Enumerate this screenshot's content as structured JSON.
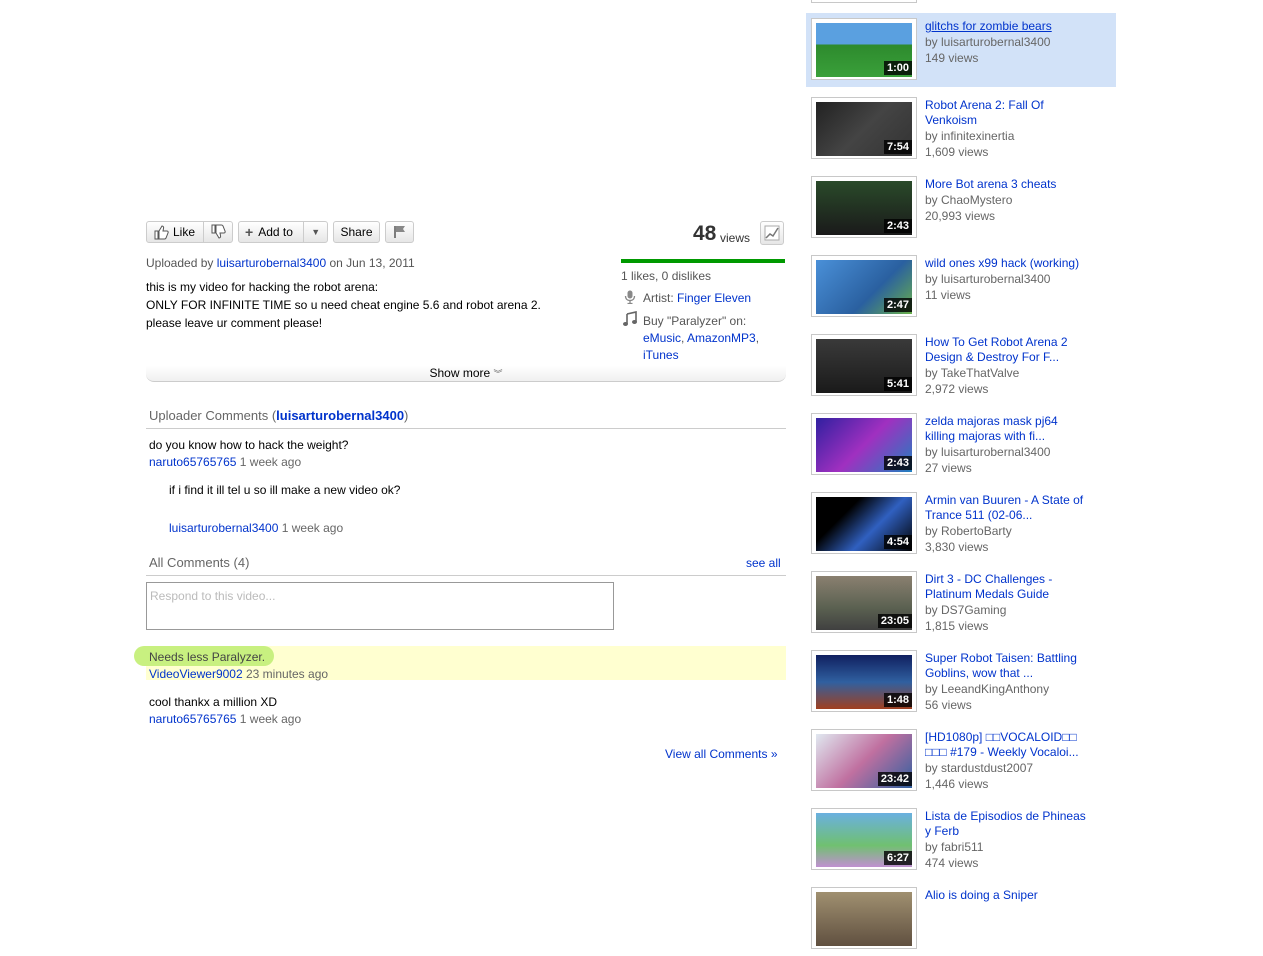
{
  "actions": {
    "like_label": "Like",
    "add_to_label": "Add to",
    "share_label": "Share"
  },
  "views": {
    "count": "48",
    "word": "views"
  },
  "ratings": {
    "text": "1 likes, 0 dislikes",
    "like_fraction": 1.0
  },
  "upload": {
    "prefix": "Uploaded by",
    "user": "luisarturobernal3400",
    "on": "on Jun 13, 2011"
  },
  "description": [
    "this is my video for hacking the robot arena:",
    "ONLY FOR INFINITE TIME so u need cheat engine 5.6 and robot arena 2.",
    "please leave ur comment please!"
  ],
  "music": {
    "artist_prefix": "Artist:",
    "artist": "Finger Eleven",
    "buy_prefix": "Buy \"Paralyzer\" on:",
    "stores": [
      "eMusic",
      "AmazonMP3",
      "iTunes"
    ]
  },
  "show_more": "Show more",
  "uploader_comments": {
    "title_prefix": "Uploader Comments (",
    "title_user": "luisarturobernal3400",
    "title_suffix": ")",
    "items": [
      {
        "text": "do you know how to hack the weight?",
        "user": "naruto65765765",
        "time": "1 week ago"
      },
      {
        "text": "if i find it ill tel u so ill make a new video ok?",
        "user": "luisarturobernal3400",
        "time": "1 week ago"
      }
    ]
  },
  "all_comments": {
    "title": "All Comments (4)",
    "see_all": "see all",
    "placeholder": "Respond to this video...",
    "items": [
      {
        "text": "Needs less Paralyzer.",
        "user": "VideoViewer9002",
        "time": "23 minutes ago"
      },
      {
        "text": "cool thankx a million XD",
        "user": "naruto65765765",
        "time": "1 week ago"
      }
    ],
    "view_all": "View all Comments »"
  },
  "sidebar": [
    {
      "title1": "glitchs for zombie bears",
      "title2": "",
      "by": "by luisarturobernal3400",
      "views": "149 views",
      "duration": "1:00",
      "active": true
    },
    {
      "title1": "Robot Arena 2: Fall Of",
      "title2": "Venkoism",
      "by": "by infinitexinertia",
      "views": "1,609 views",
      "duration": "7:54"
    },
    {
      "title1": "More Bot arena 3 cheats",
      "title2": "",
      "by": "by ChaoMystero",
      "views": "20,993 views",
      "duration": "2:43"
    },
    {
      "title1": "wild ones x99 hack (working)",
      "title2": "",
      "by": "by luisarturobernal3400",
      "views": "11 views",
      "duration": "2:47"
    },
    {
      "title1": "How To Get Robot Arena 2",
      "title2": "Design & Destroy For F...",
      "by": "by TakeThatValve",
      "views": "2,972 views",
      "duration": "5:41"
    },
    {
      "title1": "zelda majoras mask pj64",
      "title2": "killing majoras with fi...",
      "by": "by luisarturobernal3400",
      "views": "27 views",
      "duration": "2:43"
    },
    {
      "title1": "Armin van Buuren - A State of",
      "title2": "Trance 511 (02-06...",
      "by": "by RobertoBarty",
      "views": "3,830 views",
      "duration": "4:54"
    },
    {
      "title1": "Dirt 3 - DC Challenges -",
      "title2": "Platinum Medals Guide",
      "by": "by DS7Gaming",
      "views": "1,815 views",
      "duration": "23:05"
    },
    {
      "title1": "Super Robot Taisen: Battling",
      "title2": "Goblins, wow that ...",
      "by": "by LeeandKingAnthony",
      "views": "56 views",
      "duration": "1:48"
    },
    {
      "title1": "[HD1080p] □□VOCALOID□□",
      "title2": "□□□ #179 - Weekly Vocaloi...",
      "by": "by stardustdust2007",
      "views": "1,446 views",
      "duration": "23:42"
    },
    {
      "title1": "Lista de Episodios de Phineas",
      "title2": "y Ferb",
      "by": "by fabri511",
      "views": "474 views",
      "duration": "6:27"
    },
    {
      "title1": "Alio is doing a Sniper",
      "title2": "",
      "by": "",
      "views": "",
      "duration": ""
    }
  ]
}
